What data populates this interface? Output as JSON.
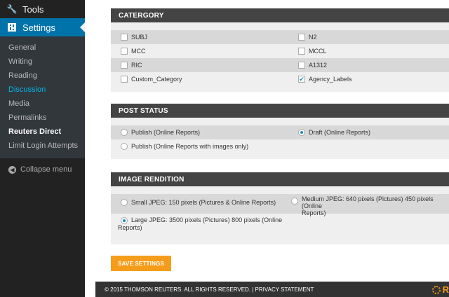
{
  "sidebar": {
    "tools_label": "Tools",
    "settings_label": "Settings",
    "submenu": [
      "General",
      "Writing",
      "Reading",
      "Discussion",
      "Media",
      "Permalinks",
      "Reuters Direct",
      "Limit Login Attempts"
    ],
    "collapse_label": "Collapse menu"
  },
  "category": {
    "title": "CATERGORY",
    "rows": [
      [
        {
          "label": "SUBJ",
          "checked": false
        },
        {
          "label": "N2",
          "checked": false
        }
      ],
      [
        {
          "label": "MCC",
          "checked": false
        },
        {
          "label": "MCCL",
          "checked": false
        }
      ],
      [
        {
          "label": "RIC",
          "checked": false
        },
        {
          "label": "A1312",
          "checked": false
        }
      ],
      [
        {
          "label": "Custom_Category",
          "checked": false
        },
        {
          "label": "Agency_Labels",
          "checked": true
        }
      ]
    ]
  },
  "post_status": {
    "title": "POST STATUS",
    "opt1": "Publish (Online Reports)",
    "opt2": "Draft (Online Reports)",
    "opt3": "Publish (Online Reports with images only)",
    "selected": "Draft (Online Reports)"
  },
  "image_rendition": {
    "title": "IMAGE RENDITION",
    "opt1": "Small JPEG: 150 pixels (Pictures & Online Reports)",
    "opt2_line1": "Medium JPEG: 640 pixels (Pictures) 450 pixels (Online",
    "opt2_line2": "Reports)",
    "opt3_line1": "Large JPEG: 3500 pixels (Pictures) 800 pixels (Online",
    "opt3_line2": "Reports)",
    "selected": "Large JPEG"
  },
  "save_label": "SAVE SETTINGS",
  "footer": {
    "copyright": "© 2015 THOMSON REUTERS. ALL RIGHTS RESERVED. | PRIVACY STATEMENT",
    "logo_text": "R"
  },
  "colors": {
    "accent": "#0073aa",
    "button": "#f59d1b",
    "panel_header": "#444444"
  }
}
